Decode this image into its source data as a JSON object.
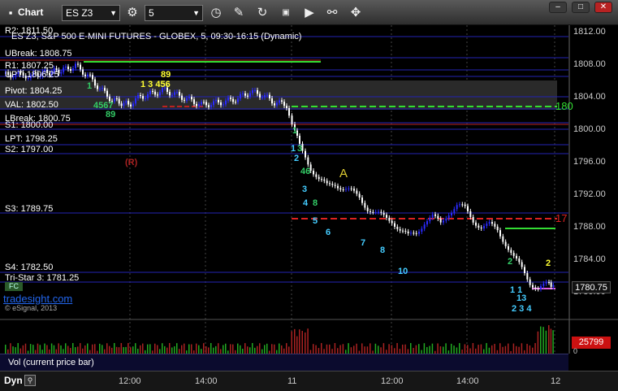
{
  "window": {
    "title": "Chart",
    "symbol": "ES Z3",
    "interval": "5"
  },
  "header": {
    "description": "ES Z3, S&P 500 E-MINI FUTURES - GLOBEX, 5, 09:30-16:15 (Dynamic)"
  },
  "levels": {
    "r2": "R2: 1811.50",
    "ubreak": "UBreak: 1808.75",
    "r1": "R1: 1807.25",
    "upt": "UPT: 1806.25",
    "pivot": "Pivot: 1804.25",
    "val": "VAL: 1802.50",
    "lbreak": "LBreak: 1800.75",
    "s1": "S1: 1800.00",
    "lpt": "LPT: 1798.25",
    "s2": "S2: 1797.00",
    "s3": "S3: 1789.75",
    "s4": "S4: 1782.50",
    "tristar": "Tri-Star 3: 1781.25"
  },
  "annotations": {
    "r_marker": "(R)",
    "a_marker": "A",
    "right_label_green": "180",
    "right_label_red": "17"
  },
  "price_axis": [
    "1812.00",
    "1808.00",
    "1804.00",
    "1800.00",
    "1796.00",
    "1792.00",
    "1788.00",
    "1784.00",
    "1780.00"
  ],
  "current_price": "1780.75",
  "watermark": {
    "brand": "tradesight.com",
    "copyright": "© eSignal, 2013"
  },
  "volume_panel": {
    "label": "Vol (current price bar)",
    "value": "25799",
    "zero": "0"
  },
  "time_axis": [
    "12:00",
    "14:00",
    "11",
    "12:00",
    "14:00",
    "12"
  ],
  "bottom": {
    "mode": "Dyn"
  },
  "colors": {
    "bull": "#2a2aff",
    "bear": "#ffffff",
    "level_line": "#2020b0",
    "green": "#33dd33",
    "red": "#dd2222",
    "price_badge": "#cc1111"
  }
}
